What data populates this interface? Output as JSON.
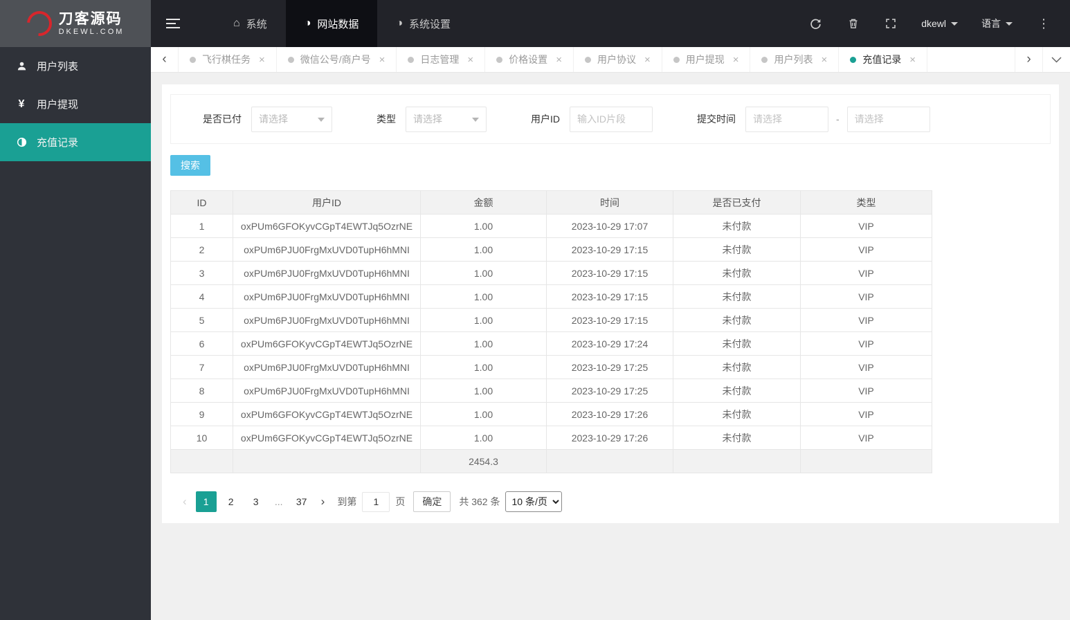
{
  "colors": {
    "accent_teal": "#1aa094",
    "search_button_blue": "#55c0e5",
    "topbar_bg": "#222329",
    "sidebar_bg": "#2f3239"
  },
  "topbar": {
    "logo": {
      "title": "刀客源码",
      "subtitle": "DKEWL.COM"
    },
    "nav": [
      {
        "label": "系统"
      },
      {
        "label": "网站数据",
        "active": true
      },
      {
        "label": "系统设置"
      }
    ],
    "username": "dkewl",
    "language_label": "语言"
  },
  "sidebar": {
    "items": [
      {
        "label": "用户列表"
      },
      {
        "label": "用户提现"
      },
      {
        "label": "充值记录",
        "active": true
      }
    ]
  },
  "tabs": [
    {
      "label": "飞行棋任务"
    },
    {
      "label": "微信公号/商户号"
    },
    {
      "label": "日志管理"
    },
    {
      "label": "价格设置"
    },
    {
      "label": "用户协议"
    },
    {
      "label": "用户提现"
    },
    {
      "label": "用户列表"
    },
    {
      "label": "充值记录",
      "active": true
    }
  ],
  "filters": {
    "paid_label": "是否已付",
    "paid_placeholder": "请选择",
    "type_label": "类型",
    "type_placeholder": "请选择",
    "userid_label": "用户ID",
    "userid_placeholder": "输入ID片段",
    "time_label": "提交时间",
    "time_placeholder_start": "请选择",
    "time_placeholder_end": "请选择",
    "separator": "-"
  },
  "search_button": "搜索",
  "table": {
    "headers": [
      "ID",
      "用户ID",
      "金额",
      "时间",
      "是否已支付",
      "类型"
    ],
    "rows": [
      [
        "1",
        "oxPUm6GFOKyvCGpT4EWTJq5OzrNE",
        "1.00",
        "2023-10-29 17:07",
        "未付款",
        "VIP"
      ],
      [
        "2",
        "oxPUm6PJU0FrgMxUVD0TupH6hMNI",
        "1.00",
        "2023-10-29 17:15",
        "未付款",
        "VIP"
      ],
      [
        "3",
        "oxPUm6PJU0FrgMxUVD0TupH6hMNI",
        "1.00",
        "2023-10-29 17:15",
        "未付款",
        "VIP"
      ],
      [
        "4",
        "oxPUm6PJU0FrgMxUVD0TupH6hMNI",
        "1.00",
        "2023-10-29 17:15",
        "未付款",
        "VIP"
      ],
      [
        "5",
        "oxPUm6PJU0FrgMxUVD0TupH6hMNI",
        "1.00",
        "2023-10-29 17:15",
        "未付款",
        "VIP"
      ],
      [
        "6",
        "oxPUm6GFOKyvCGpT4EWTJq5OzrNE",
        "1.00",
        "2023-10-29 17:24",
        "未付款",
        "VIP"
      ],
      [
        "7",
        "oxPUm6PJU0FrgMxUVD0TupH6hMNI",
        "1.00",
        "2023-10-29 17:25",
        "未付款",
        "VIP"
      ],
      [
        "8",
        "oxPUm6PJU0FrgMxUVD0TupH6hMNI",
        "1.00",
        "2023-10-29 17:25",
        "未付款",
        "VIP"
      ],
      [
        "9",
        "oxPUm6GFOKyvCGpT4EWTJq5OzrNE",
        "1.00",
        "2023-10-29 17:26",
        "未付款",
        "VIP"
      ],
      [
        "10",
        "oxPUm6GFOKyvCGpT4EWTJq5OzrNE",
        "1.00",
        "2023-10-29 17:26",
        "未付款",
        "VIP"
      ]
    ],
    "total_row": {
      "amount": "2454.3"
    }
  },
  "pagination": {
    "pages": [
      "1",
      "2",
      "3",
      "...",
      "37"
    ],
    "active_page": "1",
    "goto_label": "到第",
    "goto_value": "1",
    "page_label": "页",
    "confirm": "确定",
    "total": "共 362 条",
    "per_page": "10 条/页"
  }
}
